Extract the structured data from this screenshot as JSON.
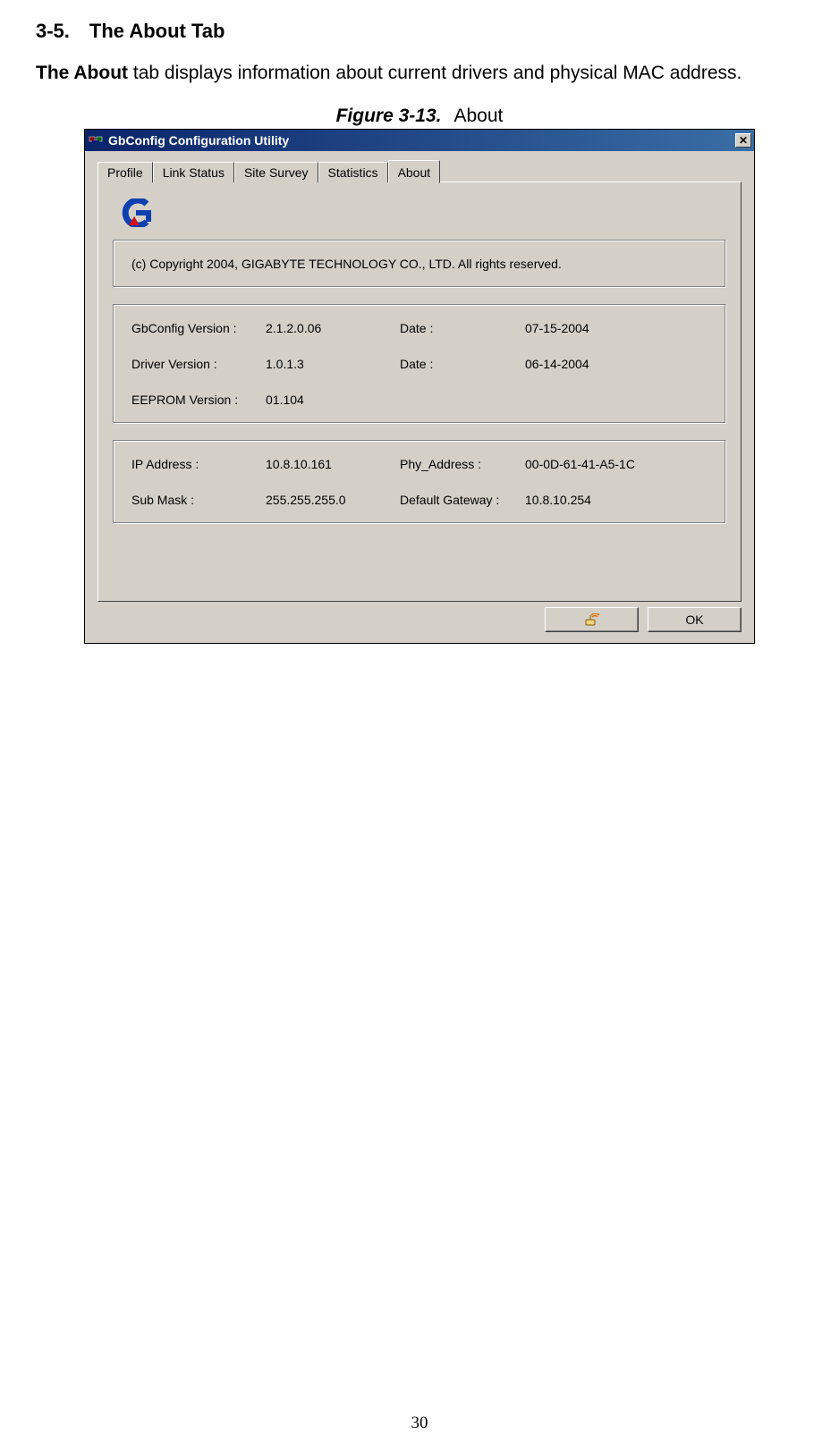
{
  "doc": {
    "heading": "3-5. The About Tab",
    "intro_bold": "The About",
    "intro_rest": " tab displays information about current drivers and physical MAC address.",
    "fig_num": "Figure 3-13.",
    "fig_title": "About",
    "page_number": "30"
  },
  "dialog": {
    "title": "GbConfig Configuration Utility",
    "close_glyph": "✕",
    "tabs": {
      "profile": "Profile",
      "link_status": "Link Status",
      "site_survey": "Site Survey",
      "statistics": "Statistics",
      "about": "About"
    },
    "copyright": "(c) Copyright 2004, GIGABYTE TECHNOLOGY CO., LTD.  All rights reserved.",
    "versions": {
      "gbconfig_label": "GbConfig Version :",
      "gbconfig_value": "2.1.2.0.06",
      "gbconfig_date_label": "Date :",
      "gbconfig_date_value": "07-15-2004",
      "driver_label": "Driver Version :",
      "driver_value": "1.0.1.3",
      "driver_date_label": "Date :",
      "driver_date_value": "06-14-2004",
      "eeprom_label": "EEPROM Version :",
      "eeprom_value": "01.104"
    },
    "network": {
      "ip_label": "IP Address :",
      "ip_value": "10.8.10.161",
      "phy_label": "Phy_Address :",
      "phy_value": "00-0D-61-41-A5-1C",
      "sub_label": "Sub Mask :",
      "sub_value": "255.255.255.0",
      "gw_label": "Default Gateway :",
      "gw_value": "10.8.10.254"
    },
    "ok_label": "OK"
  }
}
